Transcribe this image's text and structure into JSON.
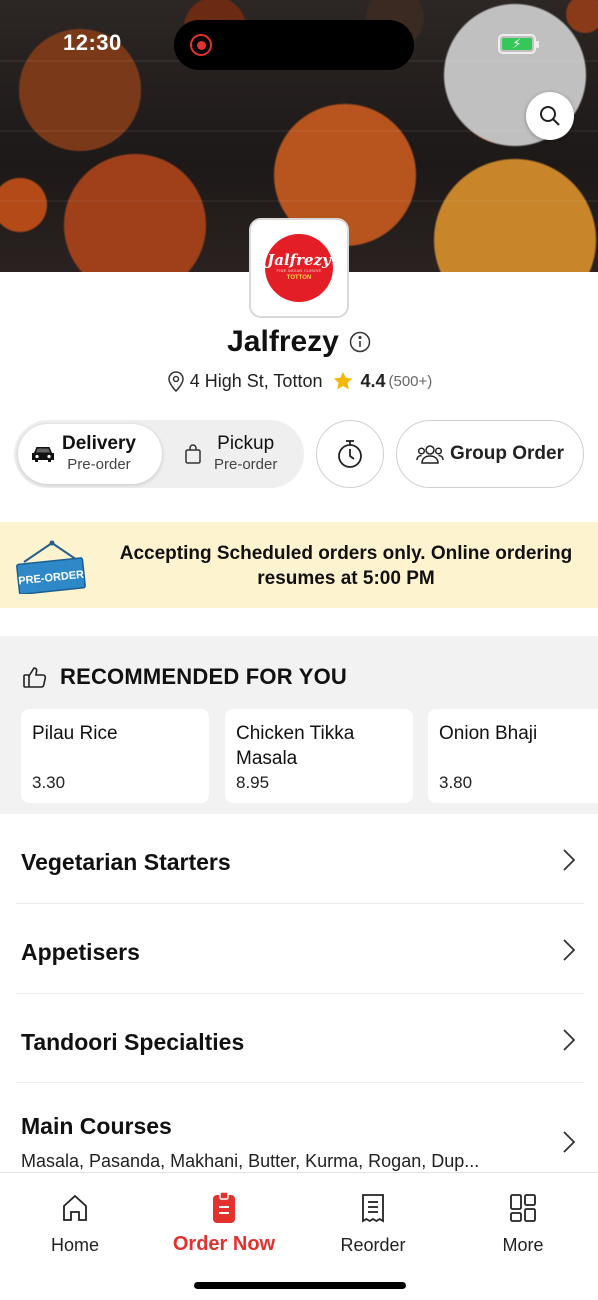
{
  "status_bar": {
    "time": "12:30"
  },
  "restaurant": {
    "logo_text": "Jalfrezy",
    "logo_tagline": "FINE INDIAN CUISINE",
    "logo_location": "TOTTON",
    "name": "Jalfrezy",
    "address": "4 High St, Totton",
    "rating": "4.4",
    "rating_count": "(500+)"
  },
  "order_mode": {
    "delivery": {
      "label": "Delivery",
      "sub": "Pre-order",
      "selected": true
    },
    "pickup": {
      "label": "Pickup",
      "sub": "Pre-order",
      "selected": false
    }
  },
  "group_order_label": "Group Order",
  "banner": {
    "sign_text": "PRE-ORDER",
    "message": "Accepting Scheduled orders only. Online ordering resumes at 5:00 PM"
  },
  "recommended": {
    "title": "RECOMMENDED FOR YOU",
    "items": [
      {
        "name": "Pilau Rice",
        "price": "3.30"
      },
      {
        "name": "Chicken Tikka Masala",
        "price": "8.95"
      },
      {
        "name": "Onion Bhaji",
        "price": "3.80"
      }
    ]
  },
  "categories": [
    {
      "name": "Vegetarian Starters"
    },
    {
      "name": "Appetisers"
    },
    {
      "name": "Tandoori Specialties"
    },
    {
      "name": "Main Courses",
      "subtitle": "Masala, Pasanda, Makhani, Butter, Kurma, Rogan, Dup..."
    }
  ],
  "tabs": [
    {
      "label": "Home",
      "icon": "home-icon",
      "active": false
    },
    {
      "label": "Order Now",
      "icon": "order-icon",
      "active": true
    },
    {
      "label": "Reorder",
      "icon": "receipt-icon",
      "active": false
    },
    {
      "label": "More",
      "icon": "grid-icon",
      "active": false
    }
  ],
  "colors": {
    "accent": "#e3322e",
    "banner_bg": "#fdf3cf",
    "star": "#f5b800"
  }
}
